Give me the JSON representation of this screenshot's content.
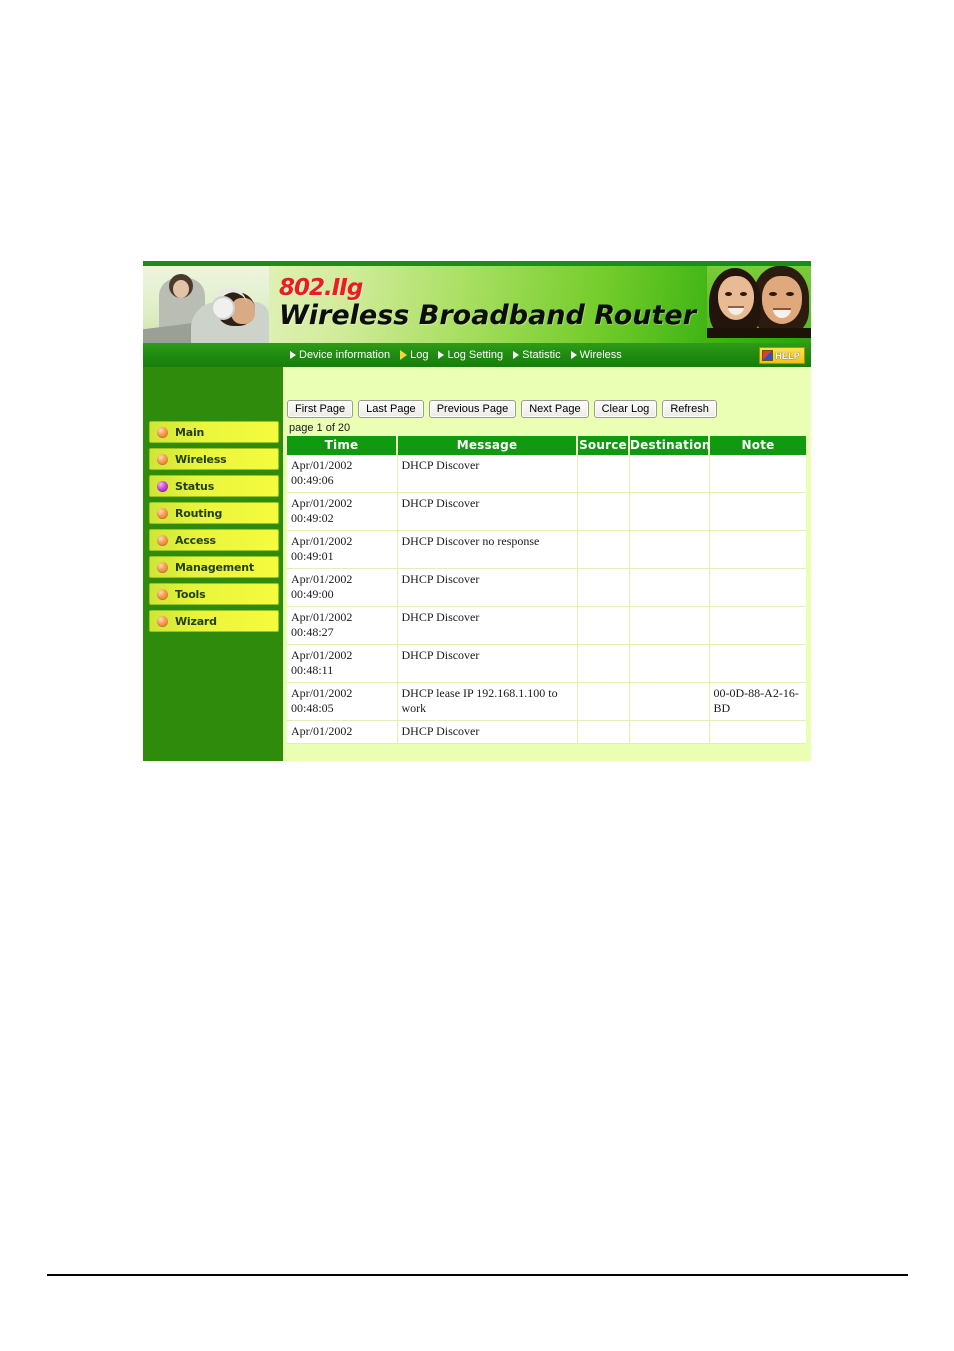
{
  "banner": {
    "brand_top": "802.IIg",
    "brand_main": "Wireless  Broadband  Router",
    "left_photo_alt": "people-with-laptop-photo",
    "right_photo_alt": "smiling-couple-photo"
  },
  "topnav": {
    "items": [
      {
        "label": "Device information",
        "active": false
      },
      {
        "label": "Log",
        "active": true
      },
      {
        "label": "Log Setting",
        "active": false
      },
      {
        "label": "Statistic",
        "active": false
      },
      {
        "label": "Wireless",
        "active": false
      }
    ],
    "help_label": "HELP"
  },
  "sidebar": {
    "items": [
      {
        "label": "Main",
        "active": false
      },
      {
        "label": "Wireless",
        "active": false
      },
      {
        "label": "Status",
        "active": true
      },
      {
        "label": "Routing",
        "active": false
      },
      {
        "label": "Access",
        "active": false
      },
      {
        "label": "Management",
        "active": false
      },
      {
        "label": "Tools",
        "active": false
      },
      {
        "label": "Wizard",
        "active": false
      }
    ]
  },
  "toolbar": {
    "first_page": "First Page",
    "last_page": "Last Page",
    "previous_page": "Previous Page",
    "next_page": "Next Page",
    "clear_log": "Clear Log",
    "refresh": "Refresh"
  },
  "log": {
    "page_indicator": "page 1 of 20",
    "columns": [
      "Time",
      "Message",
      "Source",
      "Destination",
      "Note"
    ],
    "rows": [
      {
        "date": "Apr/01/2002",
        "time": "00:49:06",
        "message": "DHCP Discover",
        "source": "",
        "destination": "",
        "note": ""
      },
      {
        "date": "Apr/01/2002",
        "time": "00:49:02",
        "message": "DHCP Discover",
        "source": "",
        "destination": "",
        "note": ""
      },
      {
        "date": "Apr/01/2002",
        "time": "00:49:01",
        "message": "DHCP Discover no response",
        "source": "",
        "destination": "",
        "note": ""
      },
      {
        "date": "Apr/01/2002",
        "time": "00:49:00",
        "message": "DHCP Discover",
        "source": "",
        "destination": "",
        "note": ""
      },
      {
        "date": "Apr/01/2002",
        "time": "00:48:27",
        "message": "DHCP Discover",
        "source": "",
        "destination": "",
        "note": ""
      },
      {
        "date": "Apr/01/2002",
        "time": "00:48:11",
        "message": "DHCP Discover",
        "source": "",
        "destination": "",
        "note": ""
      },
      {
        "date": "Apr/01/2002",
        "time": "00:48:05",
        "message": "DHCP lease IP 192.168.1.100 to work",
        "source": "",
        "destination": "",
        "note": "00-0D-88-A2-16-BD"
      },
      {
        "date": "Apr/01/2002",
        "time": "",
        "message": "DHCP Discover",
        "source": "",
        "destination": "",
        "note": ""
      }
    ]
  },
  "colors": {
    "header_green": "#0f9a0f",
    "nav_green": "#1e8a10",
    "sidebar_green": "#2e8b0c",
    "content_bg": "#eaffb4",
    "menu_yellow": "#f6fb3e",
    "brand_red": "#ed1c24",
    "active_bullet": "#cc46d6",
    "inactive_bullet": "#f59a4d"
  }
}
